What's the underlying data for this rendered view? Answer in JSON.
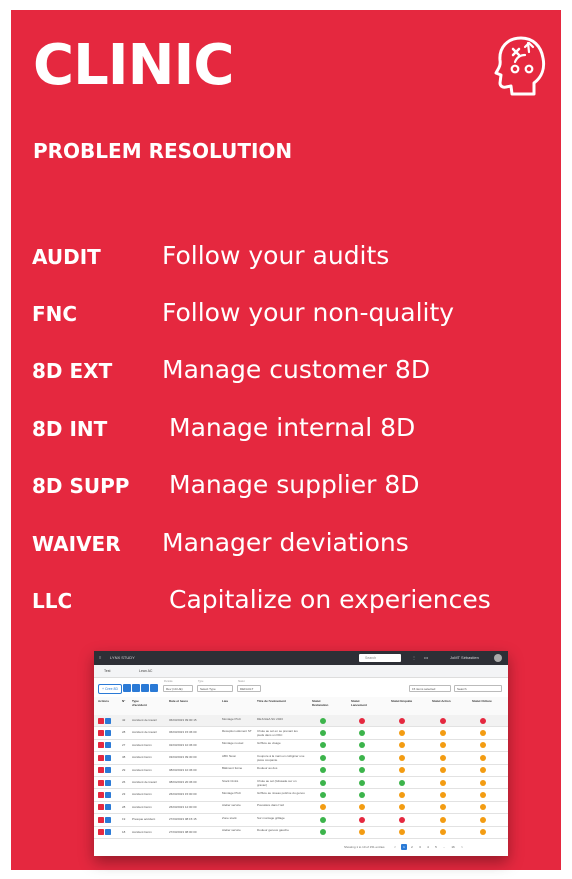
{
  "brand": {
    "title": "CLINIC",
    "subtitle": "PROBLEM RESOLUTION",
    "icon": "head-strategy-icon",
    "background": "#e5283f"
  },
  "features": [
    {
      "code": "AUDIT",
      "desc": "Follow your audits"
    },
    {
      "code": "FNC",
      "desc": "Follow your non-quality"
    },
    {
      "code": "8D  EXT",
      "desc": "Manage customer 8D"
    },
    {
      "code": "8D  INT",
      "desc": "Manage internal 8D"
    },
    {
      "code": "8D  SUPP",
      "desc": "Manage supplier 8D"
    },
    {
      "code": "WAIVER",
      "desc": "Manager deviations"
    },
    {
      "code": "LLC",
      "desc": "Capitalize on experiences"
    }
  ],
  "screenshot": {
    "topbar": {
      "app": "LYNX STUDY",
      "search_placeholder": "Search",
      "user": "JoMT Sébastien"
    },
    "tabs": [
      "Test",
      "Lean AC"
    ],
    "create_label": "+ Cree 8D",
    "filters": [
      {
        "label": "Periode",
        "value": "Rev (10-UE)"
      },
      {
        "label": "Type",
        "value": "Select Type"
      },
      {
        "label": "Statut",
        "value": "DEFAULT"
      }
    ],
    "items_selected": "15 items selected",
    "table_search": "Search",
    "columns": [
      "Actions",
      "N°",
      "Type d'accident",
      "Date et heure",
      "Lieu",
      "Titre de l'événement",
      "Statut Déclaration",
      "Statut Lancement",
      "Statut Enquête",
      "Statut Action",
      "Statut Clôture"
    ],
    "rows": [
      {
        "n": "42",
        "type": "Accident de travail",
        "date": "06/03/2023 09:00:15",
        "lieu": "Montage PGC",
        "titre": "DEJULEA SU 2023",
        "s": [
          "green",
          "red",
          "red",
          "red",
          "red"
        ]
      },
      {
        "n": "28",
        "type": "Accident de travail",
        "date": "06/03/2023 15:36:00",
        "lieu": "Réception élément ST",
        "titre": "Chute au sol en se prenant les pieds dans un PAC",
        "s": [
          "green",
          "green",
          "orange",
          "orange",
          "orange"
        ]
      },
      {
        "n": "27",
        "type": "Accident bénin",
        "date": "02/03/2023 10:36:00",
        "lieu": "Montage nouvel",
        "titre": "Griffure au visage",
        "s": [
          "green",
          "green",
          "orange",
          "orange",
          "orange"
        ]
      },
      {
        "n": "38",
        "type": "Accident bénin",
        "date": "03/03/2023 09:30:00",
        "lieu": "ABC Néon",
        "titre": "Coupure à la main en coltignier une pièce coupante",
        "s": [
          "green",
          "green",
          "orange",
          "orange",
          "orange"
        ]
      },
      {
        "n": "29",
        "type": "Accident bénin",
        "date": "08/03/2023 10:36:00",
        "lieu": "Bâtiment 3ème",
        "titre": "Douleur au dos",
        "s": [
          "green",
          "green",
          "orange",
          "orange",
          "orange"
        ]
      },
      {
        "n": "26",
        "type": "Accident de travail",
        "date": "08/04/2023 20:36:00",
        "lieu": "Stock Cintré",
        "titre": "Chute au sol (Glissade sur un gravier)",
        "s": [
          "green",
          "green",
          "green",
          "orange",
          "orange"
        ]
      },
      {
        "n": "23",
        "type": "Accident bénin",
        "date": "26/03/2023 15:00:00",
        "lieu": "Montage PGC",
        "titre": "Griffure au niveau poitrine du genou",
        "s": [
          "green",
          "green",
          "orange",
          "orange",
          "orange"
        ]
      },
      {
        "n": "28",
        "type": "Accident bénin",
        "date": "26/03/2023 12:00:00",
        "lieu": "Atelier service",
        "titre": "Poussière dans l'œil",
        "s": [
          "orange",
          "orange",
          "orange",
          "orange",
          "orange"
        ]
      },
      {
        "n": "19",
        "type": "Presque accident",
        "date": "27/03/2023 08:15:15",
        "lieu": "Zone stock",
        "titre": "Sur montage grillage",
        "s": [
          "green",
          "red",
          "red",
          "orange",
          "orange"
        ]
      },
      {
        "n": "18",
        "type": "Accident bénin",
        "date": "27/03/2023 08:00:00",
        "lieu": "Atelier service",
        "titre": "Douleur genoux gauche",
        "s": [
          "green",
          "orange",
          "orange",
          "orange",
          "orange"
        ]
      }
    ],
    "footer_text": "Showing 1 to 10 of 151 entries",
    "pages": [
      "<",
      "1",
      "2",
      "3",
      "4",
      "5",
      "...",
      "16",
      ">"
    ]
  }
}
